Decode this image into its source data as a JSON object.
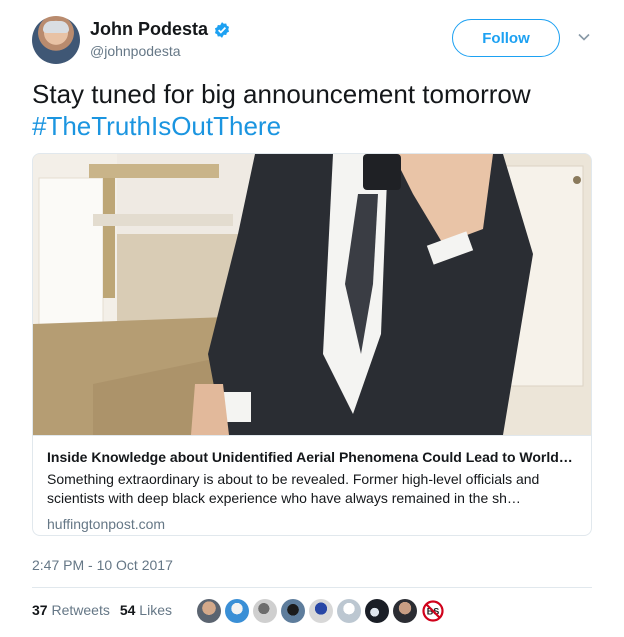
{
  "user": {
    "name": "John Podesta",
    "handle": "@johnpodesta",
    "verified": true
  },
  "follow_label": "Follow",
  "tweet": {
    "text": "Stay tuned for big announcement tomorrow",
    "hashtag": "#TheTruthIsOutThere"
  },
  "card": {
    "title": "Inside Knowledge about Unidentified Aerial Phenomena Could Lead to World…",
    "description": "Something extraordinary is about to be revealed. Former high-level officials and scientists with deep black experience who have always remained in the sh…",
    "domain": "huffingtonpost.com"
  },
  "timestamp": "2:47 PM - 10 Oct 2017",
  "stats": {
    "retweets_count": "37",
    "retweets_label": "Retweets",
    "likes_count": "54",
    "likes_label": "Likes"
  },
  "colors": {
    "accent": "#1da1f2",
    "hashtag": "#1b95e0",
    "muted": "#657786"
  }
}
